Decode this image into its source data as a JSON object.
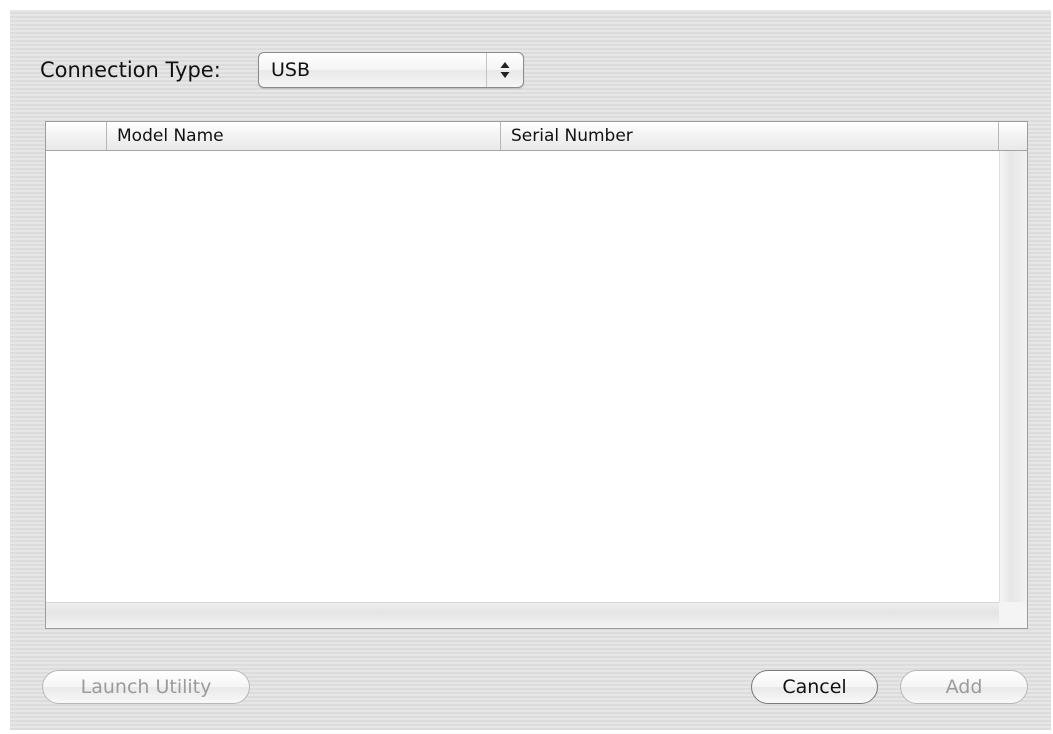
{
  "connection": {
    "label": "Connection Type:",
    "selected_value": "USB"
  },
  "table": {
    "columns": [
      "",
      "Model Name",
      "Serial Number"
    ],
    "rows": []
  },
  "buttons": {
    "launch_utility": "Launch Utility",
    "cancel": "Cancel",
    "add": "Add"
  },
  "icons": {
    "popup_arrows": "up-down-arrows-icon"
  }
}
